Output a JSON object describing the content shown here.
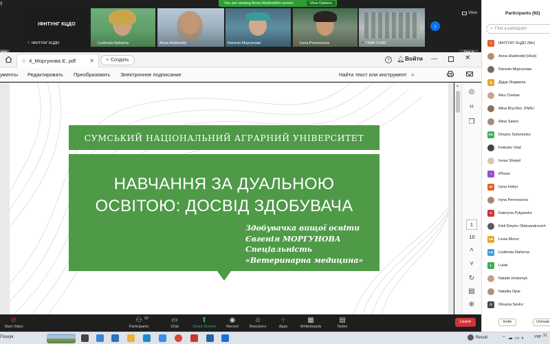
{
  "zoom_banner": {
    "text": "You are viewing Anna Hlukhodid's screen",
    "view_options": "View Options"
  },
  "video_strip": {
    "view_label": "View",
    "host_tile_label": "ІФНТУНГ КЦДО",
    "tiles": [
      {
        "name": "ІФНТУНГ КЦДО",
        "muted": true
      },
      {
        "name": "Liudmula Nahorna",
        "muted": true
      },
      {
        "name": "Anna Hlukhodid",
        "muted": false
      },
      {
        "name": "Євгенія Моргунова",
        "muted": false
      },
      {
        "name": "Iryna Perevozova",
        "muted": true
      },
      {
        "name": "ГАФК СНАУ",
        "muted": true
      }
    ]
  },
  "pdf_app": {
    "tab_title": "4_Моргунова Є. pdf",
    "new_tab_label": "Создать",
    "signin_label": "Войти",
    "menu": [
      "ументы",
      "Редактировать",
      "Преобразовать",
      "Электронное подписание"
    ],
    "find_label": "Найти текст или инструмент",
    "page_current": "1",
    "page_total": "10"
  },
  "slide": {
    "university": "СУМСЬКИЙ НАЦІОНАЛЬНИЙ АГРАРНИЙ УНІВЕРСИТЕТ",
    "title_line1": "НАВЧАННЯ ЗА ДУАЛЬНОЮ",
    "title_line2": "ОСВІТОЮ: ДОСВІД ЗДОБУВАЧА",
    "author_line1": "Здобувачка вищої освіти",
    "author_line2": "Євгенія МОРГУНОВА",
    "author_line3": "Спеціальність",
    "author_line4": "«Ветеринарна медицина»",
    "accent_color": "#4e9a47"
  },
  "zoom_toolbar": {
    "start_video": "Start Video",
    "participants": "Participants",
    "participants_count": "92",
    "chat": "Chat",
    "share_screen": "Share Screen",
    "record": "Record",
    "reactions": "Reactions",
    "apps": "Apps",
    "whiteboards": "Whiteboards",
    "notes": "Notes",
    "leave": "Leave"
  },
  "participants_panel": {
    "title": "Participants (92)",
    "search_placeholder": "Find a participant",
    "invite": "Invite",
    "unmute": "Unmute",
    "people": [
      {
        "initials": "І",
        "name": "ІФНТУНГ КЦДО (Me)",
        "color": "#e8622c",
        "photo": false
      },
      {
        "initials": "",
        "name": "Anna Hlukhodid (Host)",
        "color": "#b98a6a",
        "photo": true
      },
      {
        "initials": "",
        "name": "Євгенія Моргунова",
        "color": "#7a6a60",
        "photo": true
      },
      {
        "initials": "Д",
        "name": "Дідур Людмила",
        "color": "#e9a527",
        "photo": false
      },
      {
        "initials": "",
        "name": "Alex Chekan",
        "color": "#c7a58a",
        "photo": true
      },
      {
        "initials": "",
        "name": "Alina Brychko, SNAU",
        "color": "#8e6e5c",
        "photo": true
      },
      {
        "initials": "",
        "name": "Alina Sakun",
        "color": "#a58b7a",
        "photo": true
      },
      {
        "initials": "DS",
        "name": "Dmytro Solomonko",
        "color": "#3fae5a",
        "photo": false
      },
      {
        "initials": "",
        "name": "Fedorko Vlad",
        "color": "#444444",
        "photo": true
      },
      {
        "initials": "",
        "name": "Inesa Shepel",
        "color": "#d8c6b6",
        "photo": true
      },
      {
        "initials": "I",
        "name": "iPhone",
        "color": "#9b4fc7",
        "photo": false
      },
      {
        "initials": "IH",
        "name": "Iryna Hobyr",
        "color": "#e8622c",
        "photo": false
      },
      {
        "initials": "",
        "name": "Iryna Perevozova",
        "color": "#a5867a",
        "photo": true
      },
      {
        "initials": "K",
        "name": "Kateryna Pylypenko",
        "color": "#d23338",
        "photo": false
      },
      {
        "initials": "",
        "name": "Kisil Dmytro Oleksandrovich",
        "color": "#5b5b5b",
        "photo": true
      },
      {
        "initials": "LM",
        "name": "Lesia Moroz",
        "color": "#e9a527",
        "photo": false
      },
      {
        "initials": "LN",
        "name": "Liudmula Nahorna",
        "color": "#3aa0d8",
        "photo": false
      },
      {
        "initials": "L",
        "name": "Lutak",
        "color": "#3fae5a",
        "photo": false
      },
      {
        "initials": "",
        "name": "Natalie Hrebenyk",
        "color": "#c79e83",
        "photo": true
      },
      {
        "initials": "",
        "name": "Nataliia Opar",
        "color": "#b58f77",
        "photo": true
      },
      {
        "initials": "O",
        "name": "Oksana Savko",
        "color": "#4a4a4a",
        "photo": false
      }
    ]
  },
  "taskbar": {
    "search": "Пошук",
    "result": "Result",
    "lang": "УКР",
    "time": "31"
  },
  "edge": {
    "left_label": "g",
    "left_tab": "ding",
    "signin_tip": "Sign in"
  }
}
